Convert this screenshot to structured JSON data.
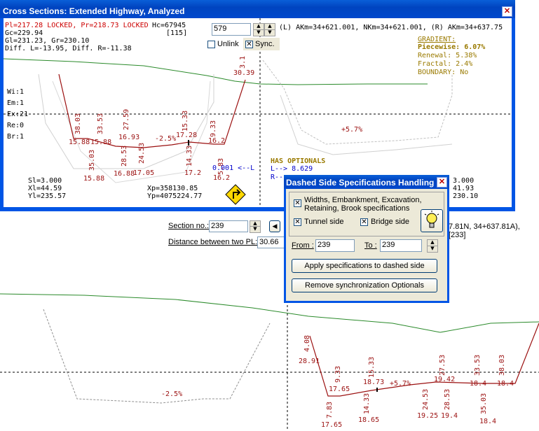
{
  "main_window": {
    "section_label": "Section no.:",
    "section_value": "239",
    "distance_label": "Distance between two PL:",
    "distance_value": "30.66",
    "right_info": "7.81N, 34+637.81A), [233]"
  },
  "cross_window": {
    "title": "Cross Sections: Extended Highway, Analyzed",
    "info": {
      "line1": "Pl=217.28 LOCKED, Pr=218.73 LOCKED",
      "hc": "Hc=67945",
      "bracket": "[115]",
      "gc": "Gc=229.94",
      "gl": "Gl=231.23, Gr=230.10",
      "diff": "Diff. L=-13.95, Diff. R=-11.38"
    },
    "section_value": "579",
    "unlink_label": "Unlink",
    "sync_label": "Sync.",
    "akm": "(L) AKm=34+621.001, NKm=34+621.001, (R) AKm=34+637.75",
    "gradient": {
      "title": "GRADIENT:",
      "piecewise": "Piecewise: 6.07%",
      "renewal": "Renewal:  5.38%",
      "fractal": "Fractal:   2.4%",
      "boundary": "BOUNDARY: No"
    },
    "side": [
      "Wi:1",
      "Em:1",
      "Ex:21",
      "Re:0",
      "Br:1"
    ],
    "bottom_left": [
      "Sl=3.000",
      "Xl=44.59",
      "Yl=235.57"
    ],
    "xp": "Xp=358130.85",
    "yp": "Yp=4075224.77",
    "optionals": {
      "title": "HAS OPTIONALS",
      "l": "L--> 8.629",
      "r": "R--"
    },
    "arrow_text": "0.001 <--L",
    "arrow_value": "16.2",
    "right_values": [
      "3.000",
      "41.93",
      "230.10"
    ],
    "grade_left": "-2.5%",
    "grade_right": "+5.7%",
    "labels": {
      "v1": "3.1",
      "v2": "30.39",
      "v3": "38.03",
      "v4": "33.53",
      "v5": "27.59",
      "v6": "15.33",
      "v7": "15.88",
      "v8": "15.88",
      "v9": "16.93",
      "v10": "17.28",
      "v11": "9.33",
      "v12": "16.2",
      "v13": "28.53",
      "v14": "24.53",
      "v15": "14.33",
      "v16": "35.03",
      "v17": "16.88",
      "v18": "17.05",
      "v19": "15.88",
      "v20": "17.2",
      "v21": "5.83"
    }
  },
  "dialog": {
    "title": "Dashed Side Specifications Handling",
    "widths_label": "Widths, Embankment, Excavation, Retaining, Brook specifications",
    "tunnel_label": "Tunnel side",
    "bridge_label": "Bridge side",
    "from_label": "From :",
    "from_value": "239",
    "to_label": "To :",
    "to_value": "239",
    "apply_button": "Apply specifications to dashed side",
    "remove_button": "Remove synchronization Optionals"
  },
  "bottom_plot": {
    "grade_left": "-2.5%",
    "grade_right": "+5.7%",
    "labels": {
      "a1": "4.08",
      "a2": "28.91",
      "a3": "9.33",
      "a4": "17.65",
      "a5": "15.33",
      "a6": "18.73",
      "a7": "27.53",
      "a8": "19.42",
      "a9": "33.53",
      "a10": "18.4",
      "a11": "38.03",
      "a12": "18.4",
      "b1": "7.83",
      "b2": "17.65",
      "b3": "14.33",
      "b4": "18.65",
      "b5": "24.53",
      "b6": "19.25",
      "b7": "28.53",
      "b8": "19.4",
      "b9": "35.03",
      "b10": "18.4"
    }
  }
}
